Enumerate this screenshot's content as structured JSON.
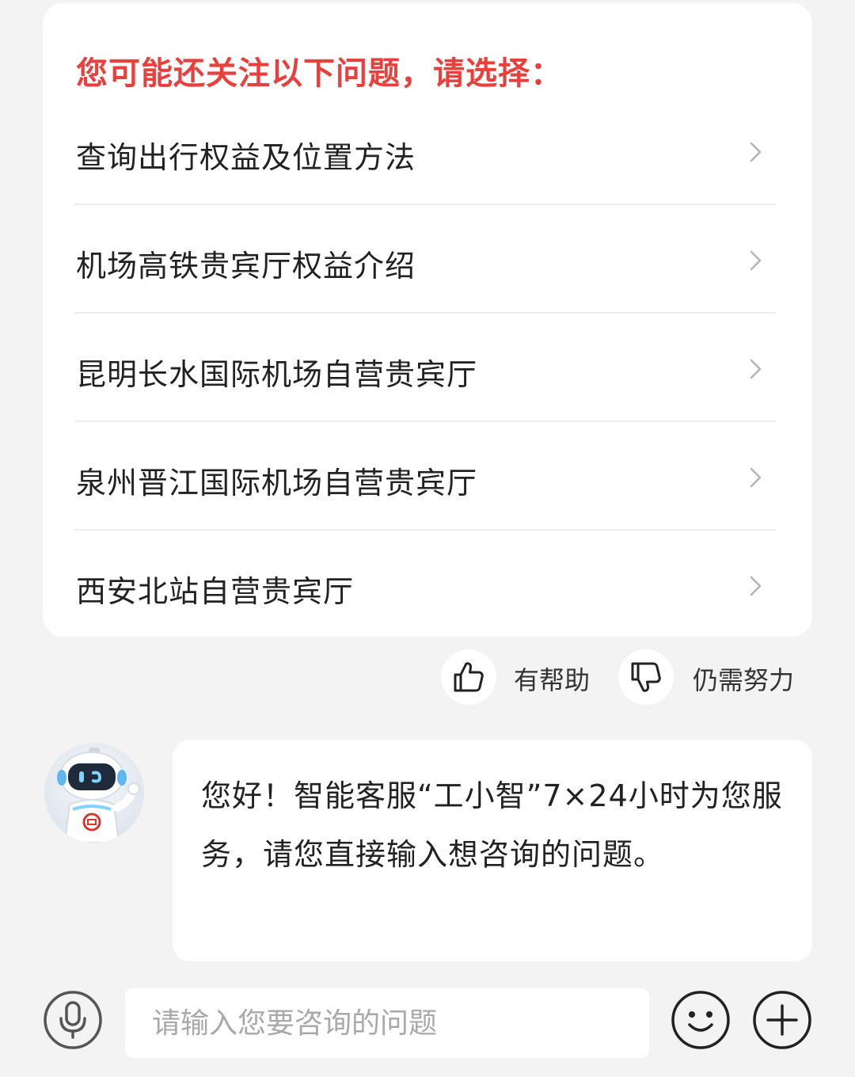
{
  "suggestions": {
    "title": "您可能还关注以下问题，请选择：",
    "items": [
      {
        "label": "查询出行权益及位置方法"
      },
      {
        "label": "机场高铁贵宾厅权益介绍"
      },
      {
        "label": "昆明长水国际机场自营贵宾厅"
      },
      {
        "label": "泉州晋江国际机场自营贵宾厅"
      },
      {
        "label": "西安北站自营贵宾厅"
      }
    ]
  },
  "feedback": {
    "helpful_label": "有帮助",
    "unhelpful_label": "仍需努力"
  },
  "message": {
    "text": "您好！智能客服“工小智”7×24小时为您服务，请您直接输入想咨询的问题。"
  },
  "input": {
    "placeholder": "请输入您要咨询的问题"
  },
  "colors": {
    "accent": "#e8403d",
    "background": "#f3f3f3",
    "card": "#ffffff"
  },
  "icons": [
    "chevron-right-icon",
    "thumbs-up-icon",
    "thumbs-down-icon",
    "microphone-icon",
    "emoji-icon",
    "plus-icon"
  ]
}
